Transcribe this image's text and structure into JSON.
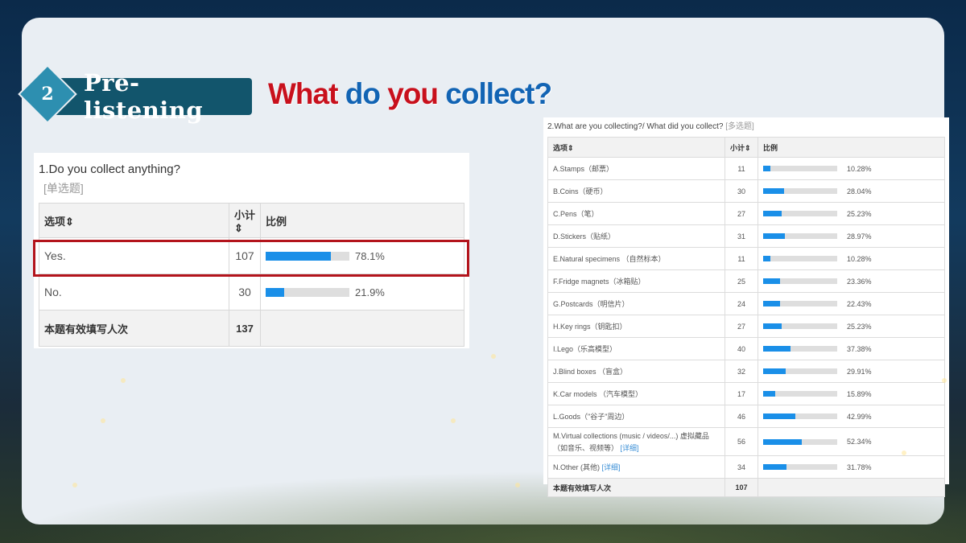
{
  "section": {
    "number": "2",
    "title": "Pre-listening"
  },
  "headline": {
    "w1": "What",
    "w2": "do",
    "w3": "you",
    "w4": "collect?"
  },
  "q1": {
    "title": "1.Do you collect anything?",
    "type": "[单选题]",
    "headers": {
      "option": "选项",
      "count": "小计",
      "ratio": "比例"
    },
    "sort_mark": "⇕",
    "rows": [
      {
        "option": "Yes.",
        "count": "107",
        "pct": "78.1%",
        "value": 78.1
      },
      {
        "option": "No.",
        "count": "30",
        "pct": "21.9%",
        "value": 21.9
      }
    ],
    "total_label": "本题有效填写人次",
    "total": "137"
  },
  "q2": {
    "title": "2.What are you collecting?/ What did you collect?",
    "type": "[多选题]",
    "headers": {
      "option": "选项",
      "count": "小计",
      "ratio": "比例"
    },
    "sort_mark": "⇕",
    "rows": [
      {
        "option": "A.Stamps（邮票）",
        "count": "11",
        "pct": "10.28%",
        "value": 10.28
      },
      {
        "option": "B.Coins（硬币）",
        "count": "30",
        "pct": "28.04%",
        "value": 28.04
      },
      {
        "option": "C.Pens（笔）",
        "count": "27",
        "pct": "25.23%",
        "value": 25.23
      },
      {
        "option": "D.Stickers（贴纸）",
        "count": "31",
        "pct": "28.97%",
        "value": 28.97
      },
      {
        "option": "E.Natural specimens （自然标本）",
        "count": "11",
        "pct": "10.28%",
        "value": 10.28
      },
      {
        "option": "F.Fridge magnets（冰箱贴）",
        "count": "25",
        "pct": "23.36%",
        "value": 23.36
      },
      {
        "option": "G.Postcards（明信片）",
        "count": "24",
        "pct": "22.43%",
        "value": 22.43
      },
      {
        "option": "H.Key rings（钥匙扣）",
        "count": "27",
        "pct": "25.23%",
        "value": 25.23
      },
      {
        "option": "I.Lego（乐高模型）",
        "count": "40",
        "pct": "37.38%",
        "value": 37.38
      },
      {
        "option": "J.Blind boxes （盲盒）",
        "count": "32",
        "pct": "29.91%",
        "value": 29.91
      },
      {
        "option": "K.Car models （汽车模型）",
        "count": "17",
        "pct": "15.89%",
        "value": 15.89
      },
      {
        "option": "L.Goods（\"谷子\"周边）",
        "count": "46",
        "pct": "42.99%",
        "value": 42.99
      },
      {
        "option": "M.Virtual collections (music / videos/...) 虚拟藏品",
        "option_line2": "（如音乐、视频等）",
        "detail": "[详细]",
        "count": "56",
        "pct": "52.34%",
        "value": 52.34
      },
      {
        "option": "N.Other (其他)",
        "detail": "[详细]",
        "count": "34",
        "pct": "31.78%",
        "value": 31.78
      }
    ],
    "total_label": "本题有效填写人次",
    "total": "107"
  },
  "colors": {
    "bar": "#1a8fe8",
    "highlight": "#b3141c",
    "headline_red": "#c8101c",
    "headline_blue": "#1264b4"
  }
}
